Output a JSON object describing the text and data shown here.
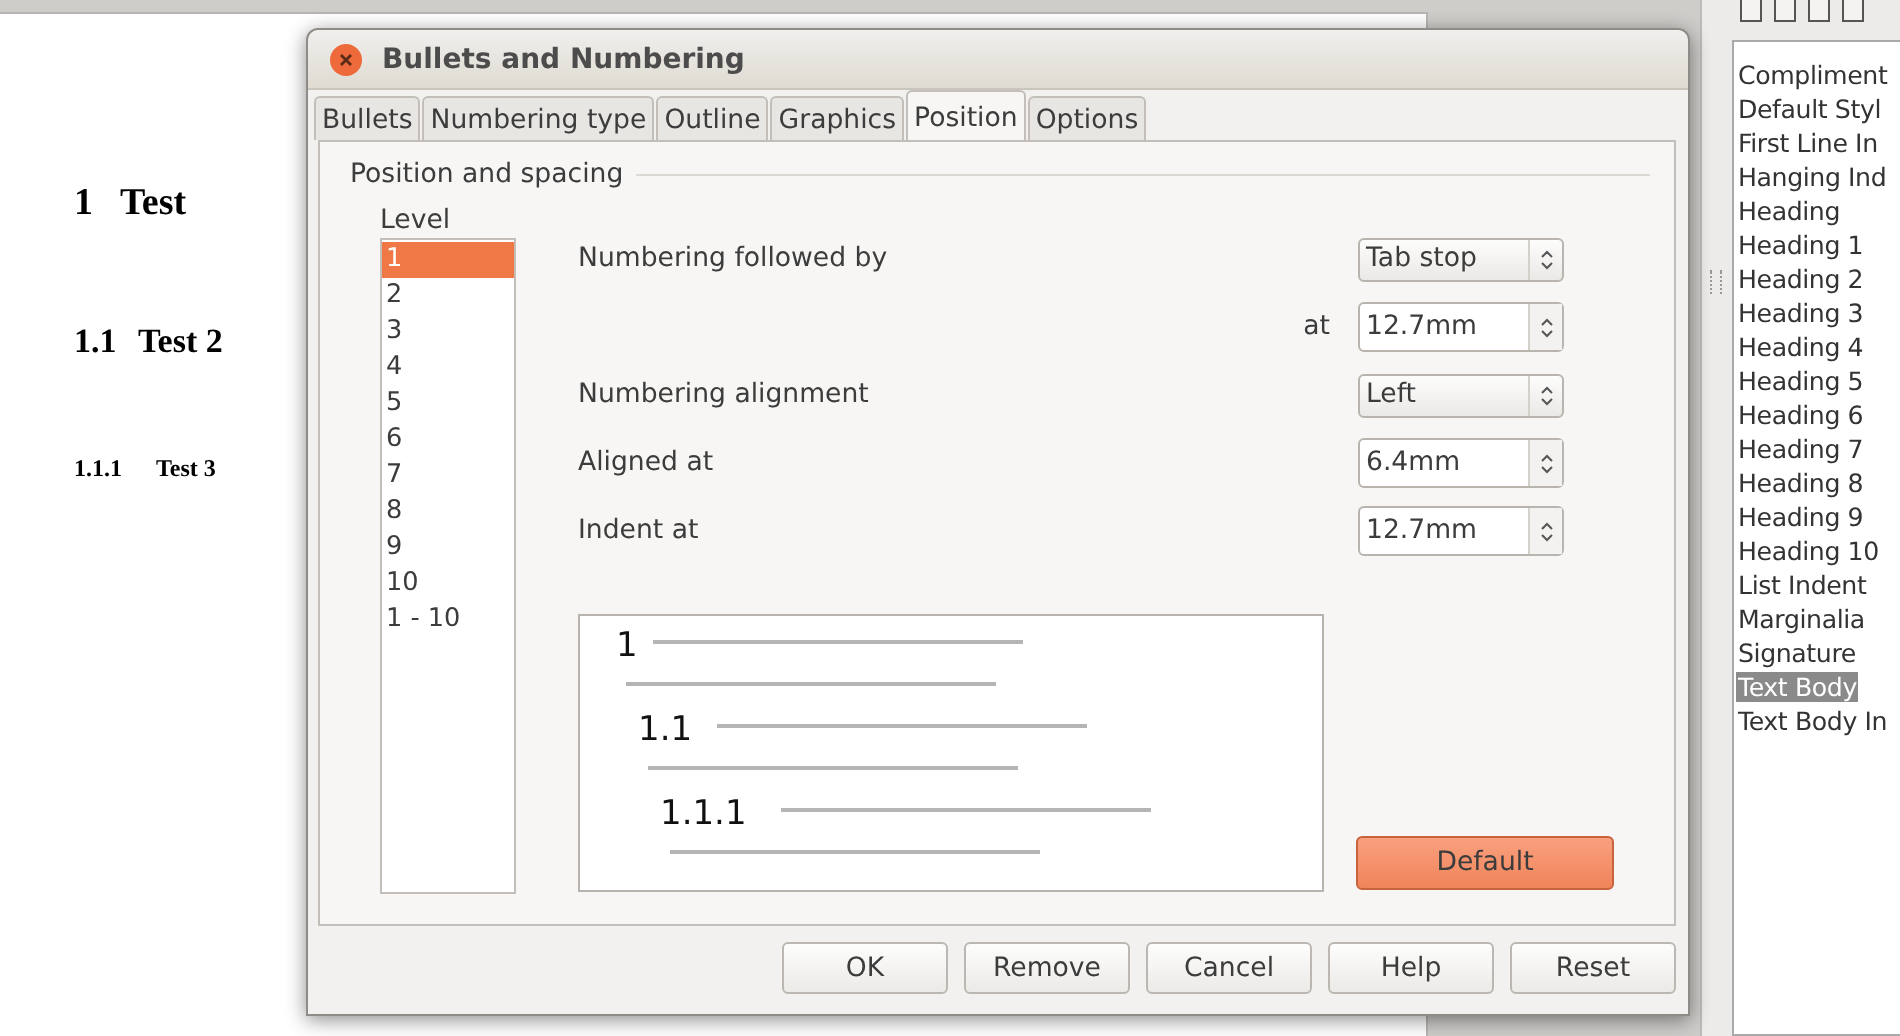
{
  "document": {
    "headings": [
      {
        "kind": "h1",
        "number": "1",
        "title": "Test"
      },
      {
        "kind": "h2",
        "number": "1.1",
        "title": "Test 2"
      },
      {
        "kind": "h3",
        "number": "1.1.1",
        "title": "Test 3"
      }
    ]
  },
  "style_panel": {
    "items": [
      {
        "label": "Compliment",
        "selected": false
      },
      {
        "label": "Default Styl",
        "selected": false
      },
      {
        "label": "First Line In",
        "selected": false
      },
      {
        "label": "Hanging Ind",
        "selected": false
      },
      {
        "label": "Heading",
        "selected": false
      },
      {
        "label": "Heading 1",
        "selected": false
      },
      {
        "label": "Heading 2",
        "selected": false
      },
      {
        "label": "Heading 3",
        "selected": false
      },
      {
        "label": "Heading 4",
        "selected": false
      },
      {
        "label": "Heading 5",
        "selected": false
      },
      {
        "label": "Heading 6",
        "selected": false
      },
      {
        "label": "Heading 7",
        "selected": false
      },
      {
        "label": "Heading 8",
        "selected": false
      },
      {
        "label": "Heading 9",
        "selected": false
      },
      {
        "label": "Heading 10",
        "selected": false
      },
      {
        "label": "List Indent",
        "selected": false
      },
      {
        "label": "Marginalia",
        "selected": false
      },
      {
        "label": "Signature",
        "selected": false
      },
      {
        "label": "Text Body",
        "selected": true
      },
      {
        "label": "Text Body In",
        "selected": false
      }
    ]
  },
  "dialog": {
    "title": "Bullets and Numbering",
    "tabs": [
      {
        "label": "Bullets",
        "selected": false
      },
      {
        "label": "Numbering type",
        "selected": false
      },
      {
        "label": "Outline",
        "selected": false
      },
      {
        "label": "Graphics",
        "selected": false
      },
      {
        "label": "Position",
        "selected": true
      },
      {
        "label": "Options",
        "selected": false
      }
    ],
    "section_title": "Position and spacing",
    "level": {
      "label": "Level",
      "items": [
        {
          "label": "1",
          "selected": true
        },
        {
          "label": "2",
          "selected": false
        },
        {
          "label": "3",
          "selected": false
        },
        {
          "label": "4",
          "selected": false
        },
        {
          "label": "5",
          "selected": false
        },
        {
          "label": "6",
          "selected": false
        },
        {
          "label": "7",
          "selected": false
        },
        {
          "label": "8",
          "selected": false
        },
        {
          "label": "9",
          "selected": false
        },
        {
          "label": "10",
          "selected": false
        },
        {
          "label": "1 - 10",
          "selected": false
        }
      ]
    },
    "fields": [
      {
        "kind": "dropdown",
        "label": "Numbering followed by",
        "value": "Tab stop"
      },
      {
        "kind": "sub-spin",
        "label": "at",
        "value": "12.7mm"
      },
      {
        "kind": "dropdown",
        "label": "Numbering alignment",
        "value": "Left"
      },
      {
        "kind": "spin",
        "label": "Aligned at",
        "value": "6.4mm"
      },
      {
        "kind": "spin",
        "label": "Indent at",
        "value": "12.7mm"
      }
    ],
    "preview": {
      "numbers": [
        "1",
        "1.1",
        "1.1.1"
      ]
    },
    "default_button": "Default",
    "buttons": [
      "OK",
      "Remove",
      "Cancel",
      "Help",
      "Reset"
    ]
  }
}
